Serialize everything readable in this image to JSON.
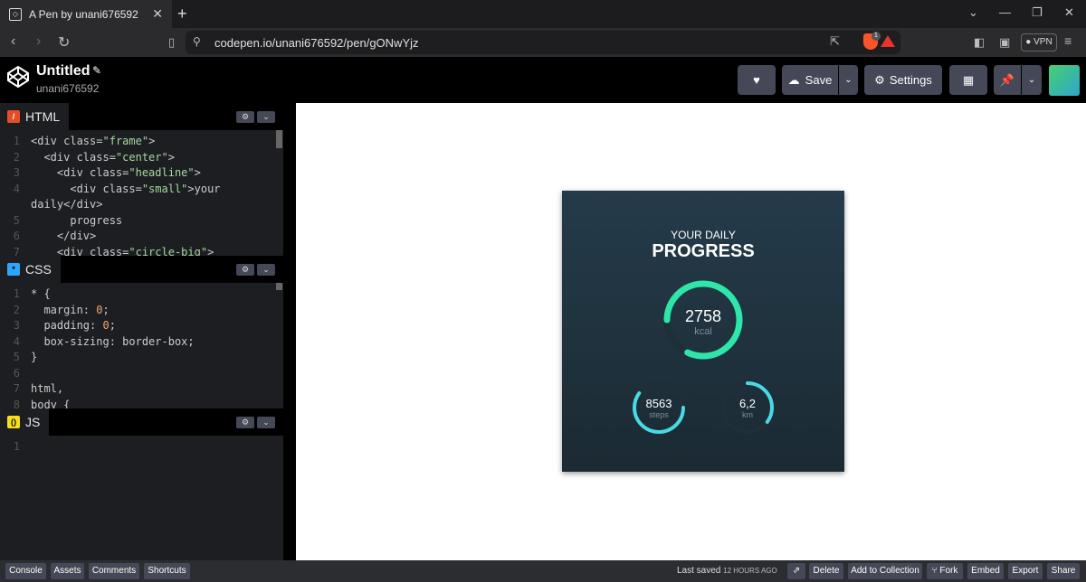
{
  "browser": {
    "tab_title": "A Pen by unani676592",
    "url": "codepen.io/unani676592/pen/gONwYjz",
    "brave_badge": "1",
    "vpn_label": "VPN"
  },
  "header": {
    "title": "Untitled",
    "username": "unani676592",
    "save_label": "Save",
    "settings_label": "Settings"
  },
  "editors": {
    "html": {
      "label": "HTML",
      "lines": [
        {
          "n": "1",
          "text": "<div class=\"frame\">"
        },
        {
          "n": "2",
          "text": "  <div class=\"center\">"
        },
        {
          "n": "3",
          "text": "    <div class=\"headline\">"
        },
        {
          "n": "4",
          "text": "      <div class=\"small\">your"
        },
        {
          "n": "",
          "text": "daily</div>"
        },
        {
          "n": "5",
          "text": "      progress"
        },
        {
          "n": "6",
          "text": "    </div>"
        },
        {
          "n": "7",
          "text": "    <div class=\"circle-big\">"
        }
      ]
    },
    "css": {
      "label": "CSS",
      "lines": [
        {
          "n": "1",
          "text": "* {"
        },
        {
          "n": "2",
          "text": "  margin: 0;"
        },
        {
          "n": "3",
          "text": "  padding: 0;"
        },
        {
          "n": "4",
          "text": "  box-sizing: border-box;"
        },
        {
          "n": "5",
          "text": "}"
        },
        {
          "n": "6",
          "text": ""
        },
        {
          "n": "7",
          "text": "html,"
        },
        {
          "n": "8",
          "text": "body {"
        }
      ]
    },
    "js": {
      "label": "JS",
      "lines": [
        {
          "n": "1",
          "text": ""
        }
      ]
    }
  },
  "preview": {
    "headline_small": "YOUR DAILY",
    "headline_big": "PROGRESS",
    "big_value": "2758",
    "big_unit": "kcal",
    "steps_value": "8563",
    "steps_unit": "steps",
    "km_value": "6,2",
    "km_unit": "km",
    "big_progress": 0.82,
    "steps_progress": 0.6,
    "km_progress": 0.35,
    "accent_big": "#2ee6a8",
    "accent_small": "#4ad9e4",
    "track": "#1e2f39"
  },
  "footer": {
    "console": "Console",
    "assets": "Assets",
    "comments": "Comments",
    "shortcuts": "Shortcuts",
    "last_saved": "Last saved",
    "last_saved_time": "12 HOURS AGO",
    "delete": "Delete",
    "add_to_collection": "Add to Collection",
    "fork": "Fork",
    "embed": "Embed",
    "export": "Export",
    "share": "Share"
  }
}
